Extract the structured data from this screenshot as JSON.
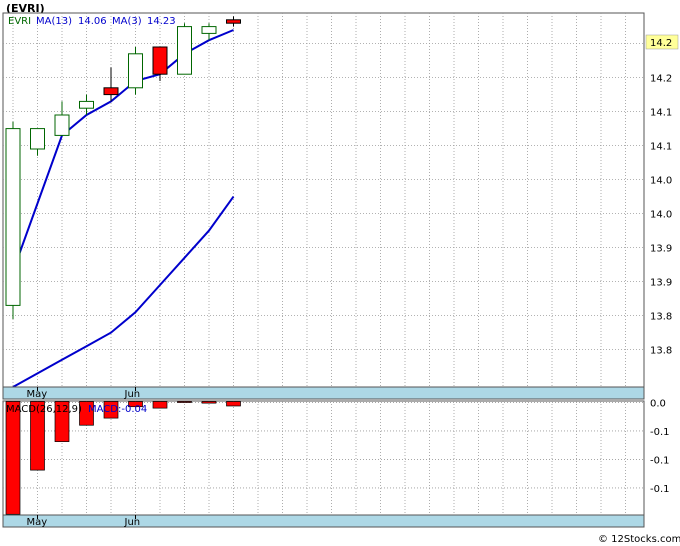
{
  "title": "(EVRI)",
  "watermark": "© 12Stocks.com",
  "legend": {
    "symbol": "EVRI",
    "ma13_label": "MA(13)",
    "ma13_value": "14.06",
    "ma3_label": "MA(3)",
    "ma3_value": "14.23"
  },
  "macd_legend": {
    "label": "MACD(26,12,9)",
    "value_label": "MACD:-0.04"
  },
  "colors": {
    "up": "#006600",
    "down": "#ff0000",
    "ma": "#0000cc",
    "grid": "#999999",
    "date_strip": "#add8e6"
  },
  "chart_data": {
    "type": "candlestick",
    "price_axis": {
      "ylim": [
        13.72,
        14.27
      ],
      "ticks": [
        {
          "value": 13.775,
          "label": "13.8"
        },
        {
          "value": 13.825,
          "label": "13.8"
        },
        {
          "value": 13.875,
          "label": "13.9"
        },
        {
          "value": 13.925,
          "label": "13.9"
        },
        {
          "value": 13.975,
          "label": "14.0"
        },
        {
          "value": 14.025,
          "label": "14.0"
        },
        {
          "value": 14.075,
          "label": "14.1"
        },
        {
          "value": 14.125,
          "label": "14.1"
        },
        {
          "value": 14.175,
          "label": "14.2"
        },
        {
          "value": 14.225,
          "label": "14.2"
        }
      ],
      "last_price_label": "14.2",
      "last_price_value": 14.24
    },
    "x_labels": [
      {
        "index": 1,
        "label": "May"
      },
      {
        "index": 5,
        "label": "Jun"
      }
    ],
    "candles": [
      {
        "open": 13.84,
        "high": 14.11,
        "low": 13.82,
        "close": 14.1
      },
      {
        "open": 14.07,
        "high": 14.1,
        "low": 14.06,
        "close": 14.1
      },
      {
        "open": 14.09,
        "high": 14.14,
        "low": 14.09,
        "close": 14.12
      },
      {
        "open": 14.13,
        "high": 14.15,
        "low": 14.12,
        "close": 14.14
      },
      {
        "open": 14.16,
        "high": 14.19,
        "low": 14.14,
        "close": 14.15
      },
      {
        "open": 14.16,
        "high": 14.22,
        "low": 14.15,
        "close": 14.21
      },
      {
        "open": 14.22,
        "high": 14.22,
        "low": 14.17,
        "close": 14.18
      },
      {
        "open": 14.18,
        "high": 14.255,
        "low": 14.18,
        "close": 14.25
      },
      {
        "open": 14.24,
        "high": 14.255,
        "low": 14.23,
        "close": 14.25
      },
      {
        "open": 14.26,
        "high": 14.265,
        "low": 14.25,
        "close": 14.255
      }
    ],
    "ma_fast": [
      13.89,
      13.99,
      14.09,
      14.12,
      14.14,
      14.17,
      14.18,
      14.21,
      14.23,
      14.245
    ],
    "ma_slow": [
      13.72,
      13.74,
      13.76,
      13.78,
      13.8,
      13.83,
      13.87,
      13.91,
      13.95,
      14.0
    ],
    "macd": {
      "ylim": [
        -0.16,
        0.0
      ],
      "ticks": [
        {
          "value": -0.002,
          "label": "0.0"
        },
        {
          "value": -0.042,
          "label": "-0.1"
        },
        {
          "value": -0.082,
          "label": "-0.1"
        },
        {
          "value": -0.122,
          "label": "-0.1"
        }
      ],
      "values": [
        -0.159,
        -0.097,
        -0.057,
        -0.034,
        -0.024,
        -0.008,
        -0.01,
        -0.002,
        -0.003,
        -0.007
      ]
    }
  }
}
